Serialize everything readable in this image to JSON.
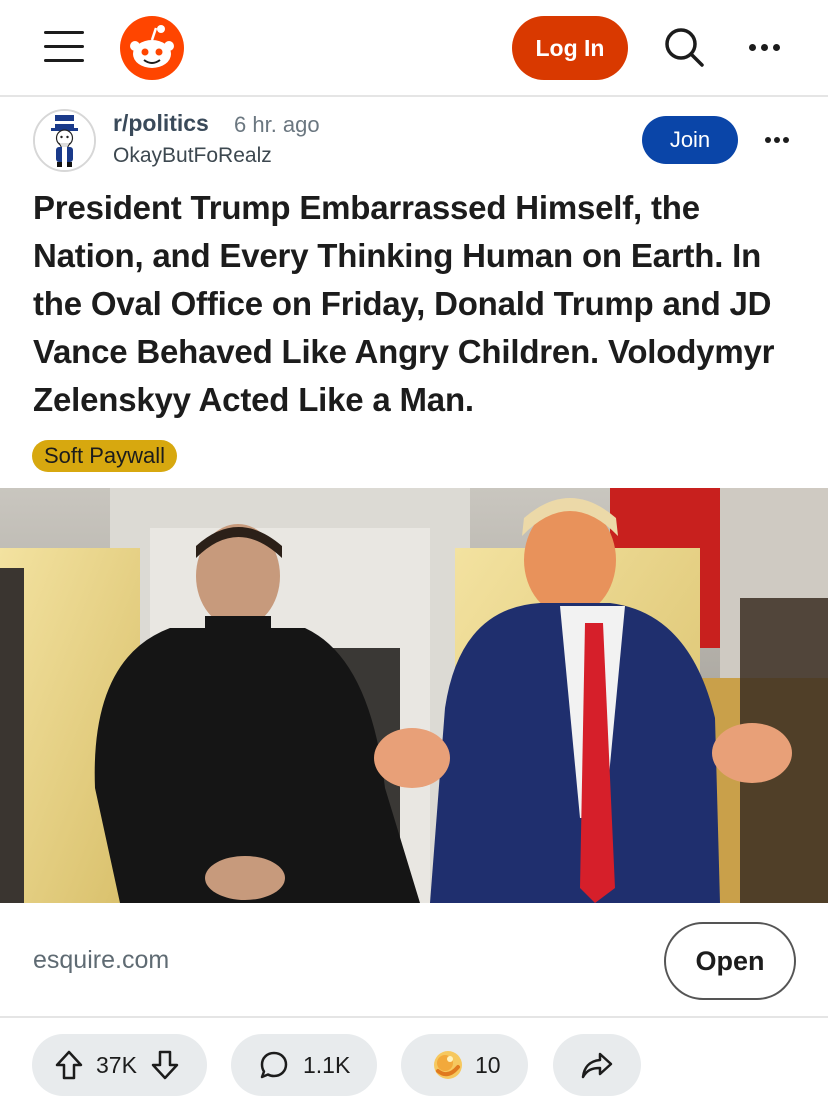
{
  "header": {
    "menu_icon": "hamburger-menu-icon",
    "logo": "reddit-snoo-logo",
    "login_label": "Log In",
    "search_icon": "search-icon",
    "more_icon": "more-horizontal-icon",
    "brand_color": "#d93900"
  },
  "post": {
    "subreddit": "r/politics",
    "time_ago": "6 hr. ago",
    "author": "OkayButFoRealz",
    "join_label": "Join",
    "join_color": "#0a45a8",
    "title": "President Trump Embarrassed Himself, the Nation, and Every Thinking Human on Earth. In the Oval Office on Friday, Donald Trump and JD Vance Behaved Like Angry Children. Volodymyr Zelenskyy Acted Like a Man.",
    "flair": "Soft Paywall",
    "flair_color": "#d7a80f",
    "link_domain": "esquire.com",
    "open_label": "Open"
  },
  "actions": {
    "votes": "37K",
    "comments": "1.1K",
    "awards": "10"
  }
}
